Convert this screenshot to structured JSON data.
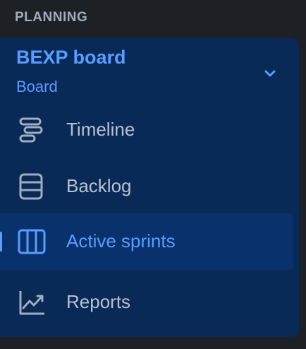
{
  "section": {
    "heading": "PLANNING"
  },
  "board": {
    "name": "BEXP board",
    "type": "Board",
    "expand_icon": "chevron-down-icon"
  },
  "nav": {
    "items": [
      {
        "label": "Timeline",
        "icon": "timeline-icon",
        "active": false
      },
      {
        "label": "Backlog",
        "icon": "backlog-icon",
        "active": false
      },
      {
        "label": "Active sprints",
        "icon": "board-columns-icon",
        "active": true
      },
      {
        "label": "Reports",
        "icon": "chart-line-icon",
        "active": false
      }
    ]
  },
  "colors": {
    "background": "#1d2125",
    "panel": "#092957",
    "active_row": "#09326c",
    "accent": "#579dff",
    "muted_text": "#b6c2cf",
    "heading_text": "#9fadbc"
  }
}
